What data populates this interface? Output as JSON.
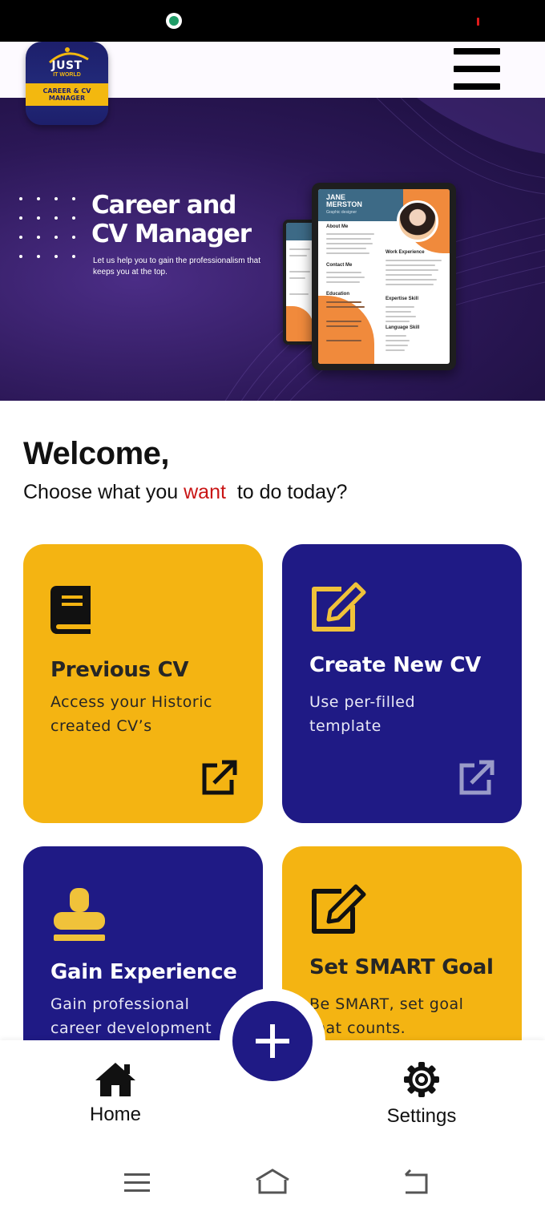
{
  "header": {
    "logo_title": "JUST",
    "logo_sub": "IT WORLD",
    "logo_band": "CAREER & CV MANAGER",
    "menu_icon": "hamburger-menu-icon"
  },
  "hero": {
    "title_line1": "Career and",
    "title_line2": "CV Manager",
    "subtitle": "Let us help you to gain the professionalism that keeps you at the top.",
    "cv_name_line1": "JANE",
    "cv_name_line2": "MERSTON",
    "cv_job": "Graphic designer",
    "cv_sections": [
      "About Me",
      "Contact Me",
      "Education",
      "Work Experience",
      "Expertise Skill",
      "Language Skill"
    ]
  },
  "welcome": {
    "title": "Welcome,",
    "subtitle_before": "Choose what you ",
    "subtitle_accent": "want",
    "subtitle_after": "  to do today?"
  },
  "cards": [
    {
      "title": "Previous CV",
      "desc_line1": "Access your Historic",
      "desc_line2": "created CV’s",
      "icon": "book-icon",
      "action_icon": "open-external-icon",
      "color": "#f4b412"
    },
    {
      "title": "Create New CV",
      "desc_line1": "Use per-filled",
      "desc_line2": "template",
      "icon": "edit-icon",
      "action_icon": "open-external-icon",
      "color": "#1f1a85"
    },
    {
      "title": "Gain Experience",
      "desc_line1": "Gain professional",
      "desc_line2": "career development",
      "icon": "stamp-icon",
      "color": "#1f1a85"
    },
    {
      "title": "Set SMART Goal",
      "desc_line1": "Be SMART, set goal",
      "desc_line2": "that counts.",
      "icon": "edit-icon",
      "color": "#f4b412"
    }
  ],
  "bottom_nav": {
    "home_label": "Home",
    "settings_label": "Settings",
    "fab_icon": "plus-icon"
  },
  "colors": {
    "accent": "#c91515",
    "yellow": "#f4b412",
    "navy": "#1f1a85"
  }
}
